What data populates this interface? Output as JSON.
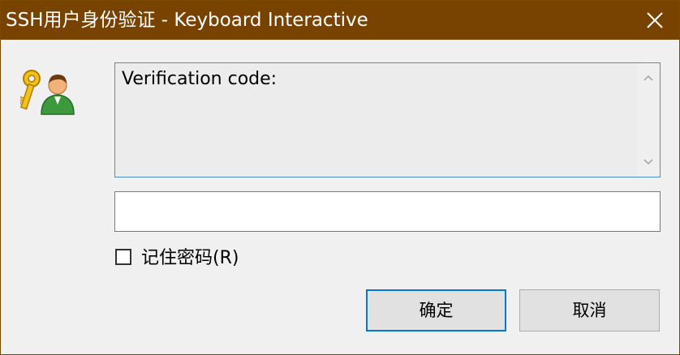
{
  "window": {
    "title": "SSH用户身份验证 - Keyboard Interactive",
    "titlebar_color": "#784300"
  },
  "icons": {
    "close": "close-icon",
    "key_user": "key-user-icon",
    "scroll_up": "chevron-up-icon",
    "scroll_down": "chevron-down-icon"
  },
  "prompt": {
    "text": "Verification code:"
  },
  "response": {
    "value": "",
    "placeholder": ""
  },
  "remember": {
    "label": "记住密码(R)",
    "checked": false
  },
  "buttons": {
    "ok_label": "确定",
    "cancel_label": "取消",
    "focus_color": "#0078d7"
  }
}
